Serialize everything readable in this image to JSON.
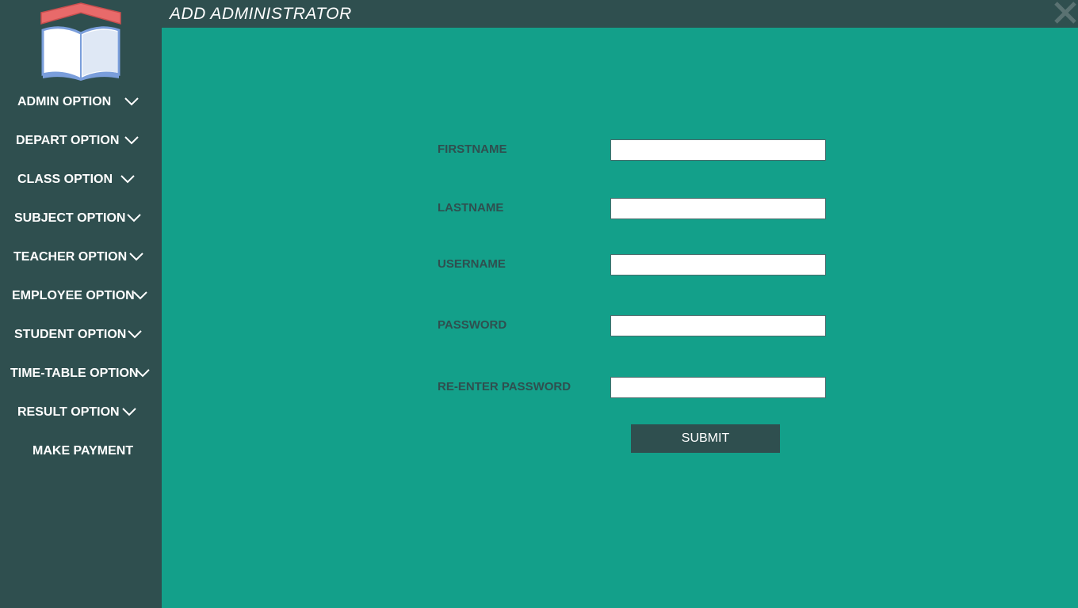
{
  "window": {
    "title": "ADD ADMINISTRATOR"
  },
  "sidebar": {
    "logo_icon": "book-house-logo",
    "items": [
      {
        "label": "ADMIN OPTION",
        "icon": "chevron-down-icon"
      },
      {
        "label": "DEPART OPTION",
        "icon": "chevron-down-icon"
      },
      {
        "label": "CLASS OPTION",
        "icon": "chevron-down-icon"
      },
      {
        "label": "SUBJECT OPTION",
        "icon": "chevron-down-icon"
      },
      {
        "label": "TEACHER OPTION",
        "icon": "chevron-down-icon"
      },
      {
        "label": "EMPLOYEE OPTION",
        "icon": "chevron-down-icon"
      },
      {
        "label": "STUDENT OPTION",
        "icon": "chevron-down-icon"
      },
      {
        "label": "TIME-TABLE OPTION",
        "icon": "chevron-down-icon"
      },
      {
        "label": "RESULT OPTION",
        "icon": "chevron-down-icon"
      },
      {
        "label": "MAKE PAYMENT"
      }
    ]
  },
  "form": {
    "fields": [
      {
        "label": "FIRSTNAME",
        "value": ""
      },
      {
        "label": "LASTNAME",
        "value": ""
      },
      {
        "label": "USERNAME",
        "value": ""
      },
      {
        "label": "PASSWORD",
        "value": ""
      },
      {
        "label": "RE-ENTER PASSWORD",
        "value": ""
      }
    ],
    "submit_label": "SUBMIT"
  },
  "colors": {
    "sidebar_bg": "#2f4f4f",
    "main_bg": "#13a08a",
    "label_text": "#2f4f4f",
    "button_bg": "#2f4f4f",
    "logo_roof": "#e86a6a",
    "logo_book": "#7a9edb"
  }
}
